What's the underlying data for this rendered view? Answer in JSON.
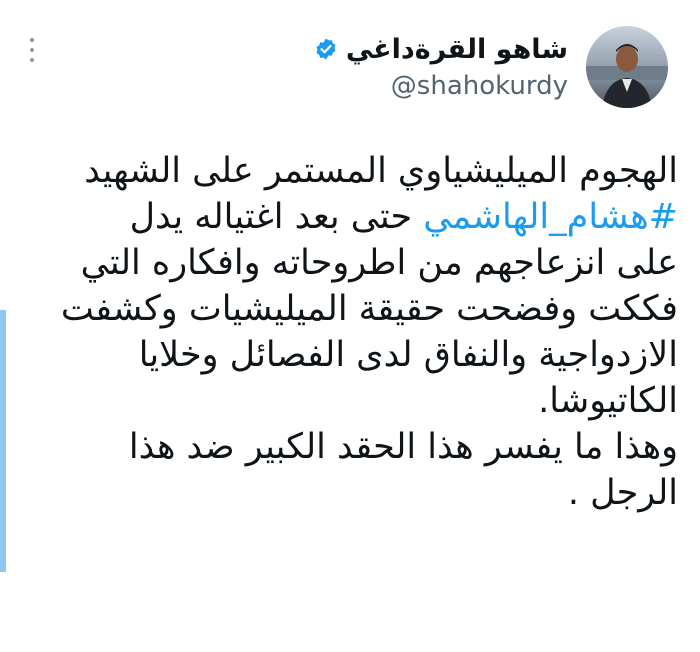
{
  "tweet_header": {
    "display_name": "شاهو القرةداغي",
    "handle": "@shahokurdy",
    "verified": true,
    "avatar_icon": "profile-photo",
    "more_icon": "more-options-vertical"
  },
  "tweet_body": {
    "line1": "الهجوم الميليشياوي المستمر على الشهيد",
    "hashtag": "#هشام_الهاشمي",
    "line2_after": " حتى بعد اغتياله يدل",
    "line3": "على انزعاجهم من اطروحاته وافكاره التي",
    "line4": "فككت وفضحت حقيقة الميليشيات وكشفت",
    "line5": "الازدواجية والنفاق لدى الفصائل وخلايا",
    "line6": "الكاتيوشا.",
    "line7": "وهذا ما يفسر هذا الحقد الكبير ضد هذا",
    "line8": "الرجل ."
  },
  "colors": {
    "hashtag": "#1d9bf0",
    "verified_badge": "#1d9bf0",
    "handle": "#536471",
    "accent_bar": "#8fc8ee"
  }
}
